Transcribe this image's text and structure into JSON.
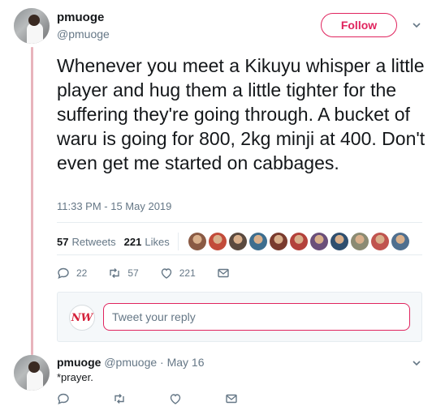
{
  "tweet": {
    "author_name": "pmuoge",
    "author_handle": "@pmuoge",
    "follow_label": "Follow",
    "text": "Whenever you meet a Kikuyu whisper a little player and hug them a little tighter for the suffering they're going through. A bucket of waru is going for 800, 2kg minji at 400. Don't even get me started on cabbages.",
    "timestamp": "11:33 PM - 15 May 2019",
    "retweets_count": "57",
    "retweets_label": "Retweets",
    "likes_count": "221",
    "likes_label": "Likes",
    "liker_avatar_colors": [
      "#8a5a44",
      "#c24b3a",
      "#5b4a3f",
      "#3d6e8f",
      "#7a3b2e",
      "#b3413b",
      "#6b4f7a",
      "#2f4f6f",
      "#8b8b73",
      "#c0544f",
      "#4f6f8f"
    ],
    "actions": {
      "reply_count": "22",
      "retweet_count": "57",
      "like_count": "221"
    }
  },
  "reply_box": {
    "logo_text": "NW",
    "placeholder": "Tweet your reply"
  },
  "reply": {
    "author_name": "pmuoge",
    "author_handle": "@pmuoge",
    "date": "· May 16",
    "text": "*prayer."
  },
  "icons": [
    "reply-icon",
    "retweet-icon",
    "like-icon",
    "dm-icon",
    "chevron-down-icon"
  ],
  "colors": {
    "accent": "#e0245e",
    "secondary_text": "#657786",
    "thread_line": "#e8b4bc"
  }
}
